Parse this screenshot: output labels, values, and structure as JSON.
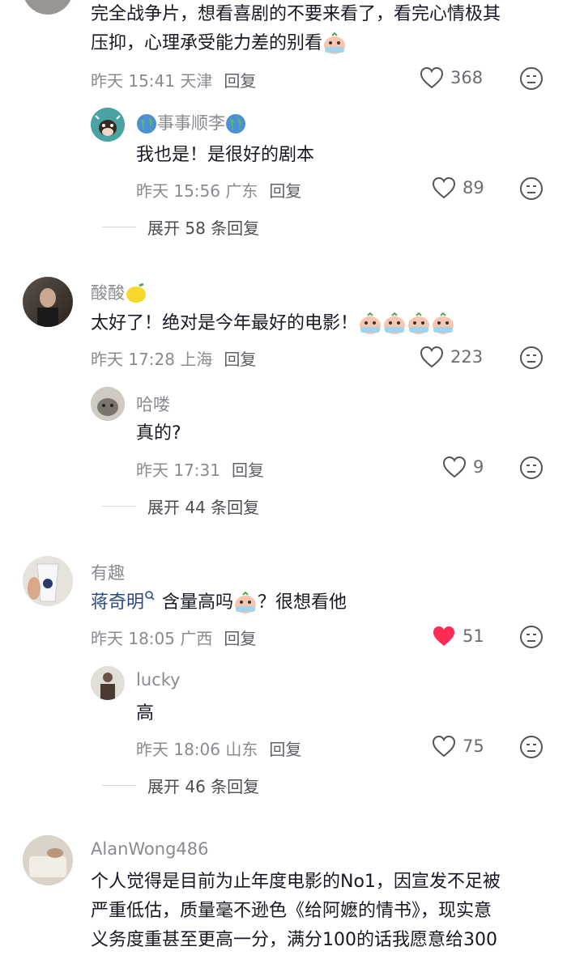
{
  "colors": {
    "accent_red": "#fe2c55",
    "meta_gray": "#8a8b91",
    "text": "#161823",
    "mention": "#2a4a86"
  },
  "comments": [
    {
      "text_line1": "完全战争片，想看喜剧的不要来看了，看完心情极其",
      "text_line2": "压抑，心理承受能力差的别看",
      "meta": "昨天 15:41 天津",
      "reply_label": "回复",
      "likes": "368",
      "replies": [
        {
          "name": "事事顺李",
          "text": "我也是！是很好的剧本",
          "meta": "昨天 15:56 广东",
          "reply_label": "回复",
          "likes": "89"
        }
      ],
      "expand": "展开 58 条回复"
    },
    {
      "name": "酸酸",
      "text": "太好了！绝对是今年最好的电影！",
      "meta": "昨天 17:28 上海",
      "reply_label": "回复",
      "likes": "223",
      "replies": [
        {
          "name": "哈喽",
          "text": "真的?",
          "meta": "昨天 17:31",
          "reply_label": "回复",
          "likes": "9"
        }
      ],
      "expand": "展开 44 条回复"
    },
    {
      "name": "有趣",
      "mention": "蒋奇明",
      "text_before": "含量高吗",
      "text_after": "？很想看他",
      "meta": "昨天 18:05 广西",
      "reply_label": "回复",
      "likes": "51",
      "liked": true,
      "replies": [
        {
          "name": "lucky",
          "text": "高",
          "meta": "昨天 18:06 山东",
          "reply_label": "回复",
          "likes": "75"
        }
      ],
      "expand": "展开 46 条回复"
    },
    {
      "name": "AlanWong486",
      "text_line1": "个人觉得是目前为止年度电影的No1，因宣发不足被",
      "text_line2": "严重低估，质量毫不逊色《给阿嬷的情书》，现实意",
      "text_line3": "义务度重甚至更高一分，满分100的话我愿意给300"
    }
  ]
}
